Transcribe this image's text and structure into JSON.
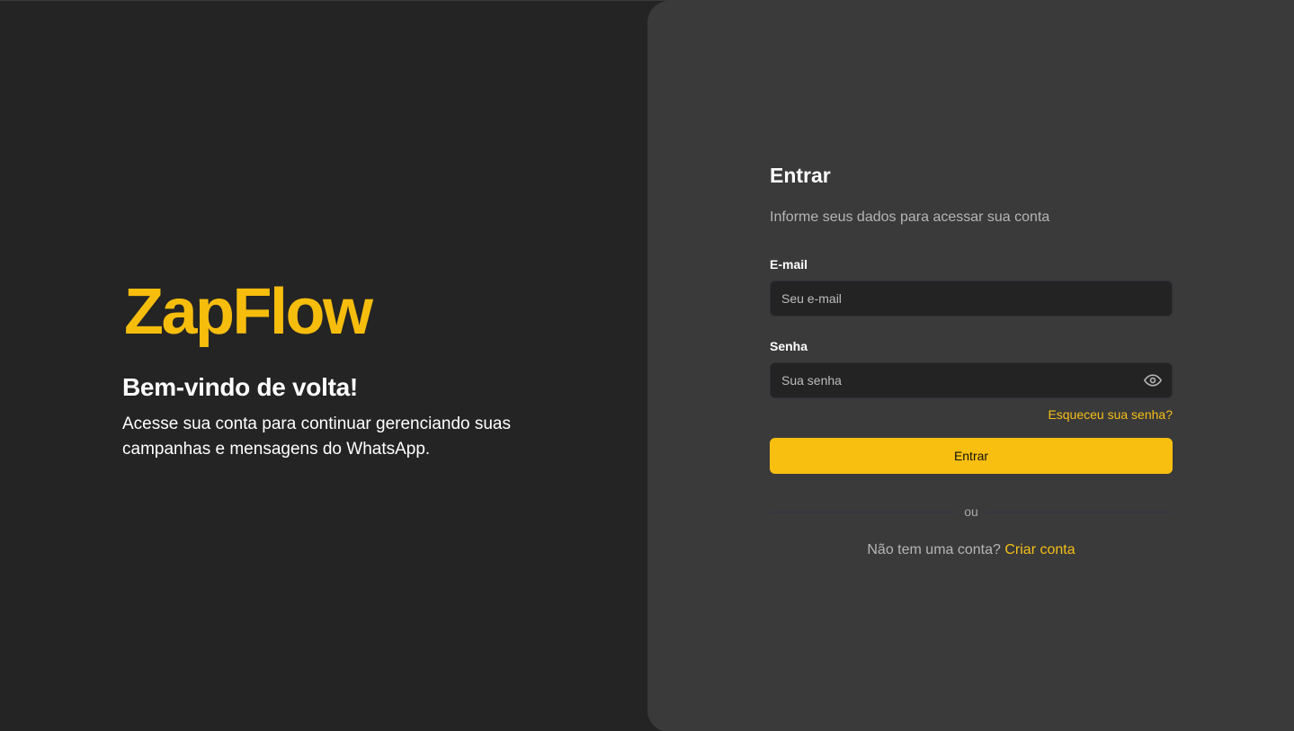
{
  "brand": {
    "logo_text": "ZapFlow",
    "accent_color": "#F8BF10"
  },
  "welcome": {
    "title": "Bem-vindo de volta!",
    "text": "Acesse sua conta para continuar gerenciando suas campanhas e mensagens do WhatsApp."
  },
  "login_form": {
    "title": "Entrar",
    "subtitle": "Informe seus dados para acessar sua conta",
    "email_label": "E-mail",
    "email_placeholder": "Seu e-mail",
    "email_value": "",
    "password_label": "Senha",
    "password_placeholder": "Sua senha",
    "password_value": "",
    "password_toggle_icon": "eye-icon",
    "forgot_password_link": "Esqueceu sua senha?",
    "submit_label": "Entrar",
    "divider_text": "ou",
    "no_account_text": "Não tem uma conta?",
    "create_account_link": "Criar conta"
  }
}
